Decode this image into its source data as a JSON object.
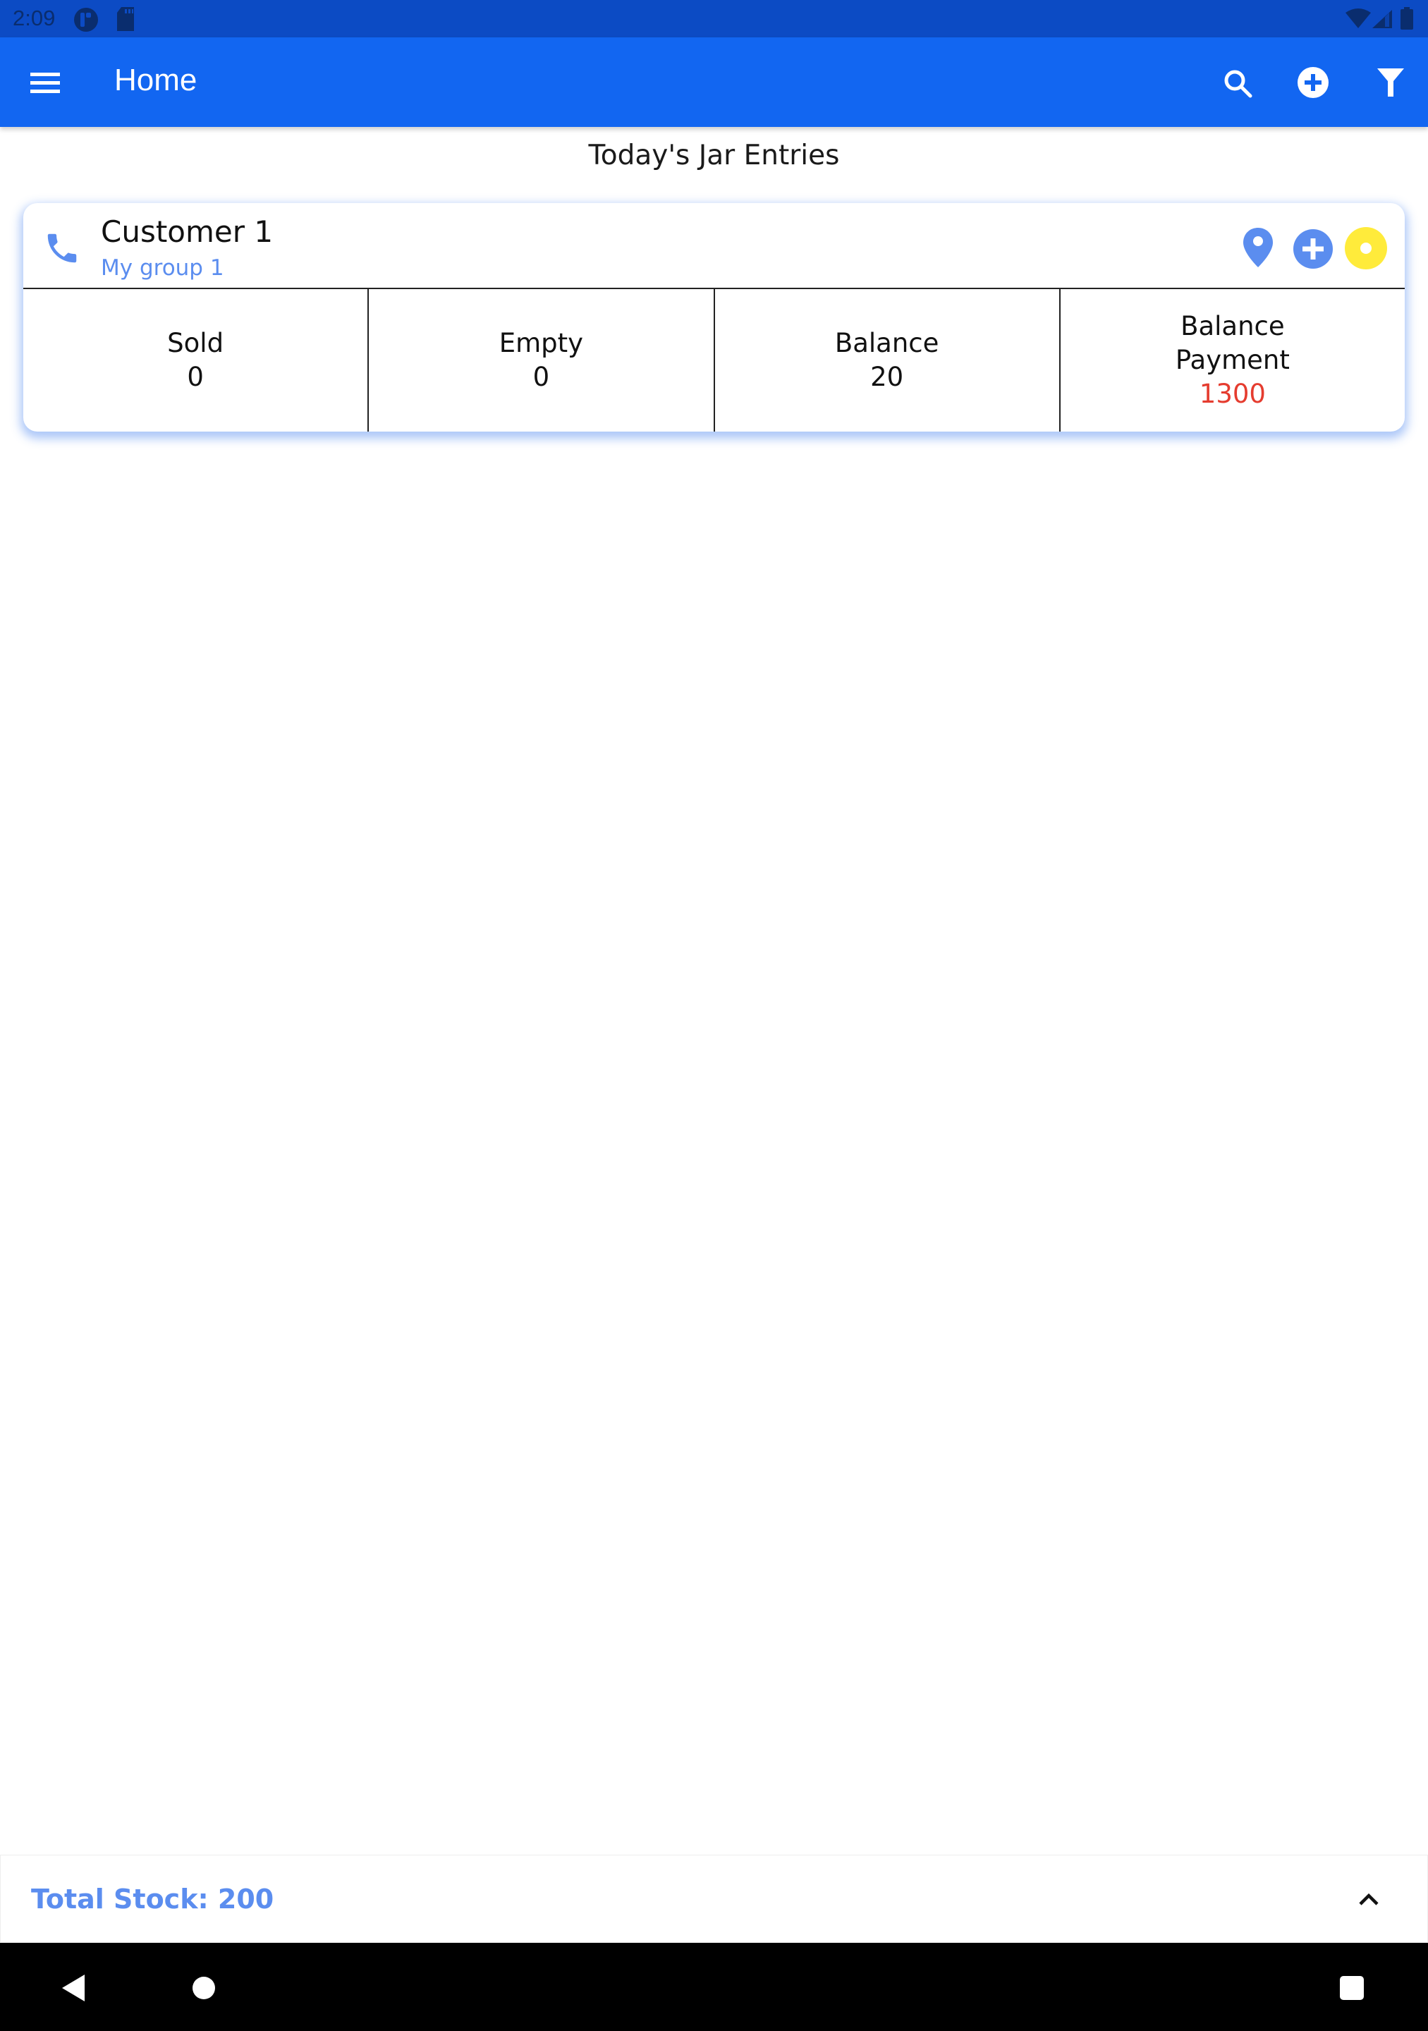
{
  "status_bar": {
    "time": "2:09",
    "left_icons": [
      "p-notification-icon",
      "sd-card-icon"
    ],
    "right_icons": [
      "wifi-icon",
      "signal-icon",
      "battery-icon"
    ]
  },
  "app_bar": {
    "title": "Home",
    "menu_icon": "hamburger-menu-icon",
    "actions": [
      {
        "name": "search",
        "icon": "search-icon"
      },
      {
        "name": "add",
        "icon": "add-circle-icon"
      },
      {
        "name": "filter",
        "icon": "filter-icon"
      }
    ]
  },
  "section": {
    "title": "Today's Jar Entries"
  },
  "entries": [
    {
      "customer_name": "Customer 1",
      "group": "My group 1",
      "icons": [
        "phone-icon",
        "location-pin-icon",
        "add-circle-icon",
        "status-dot-icon"
      ],
      "status_color": "#ffeb3b",
      "stats": [
        {
          "label": "Sold",
          "value": "0"
        },
        {
          "label": "Empty",
          "value": "0"
        },
        {
          "label": "Balance",
          "value": "20"
        },
        {
          "label_line1": "Balance",
          "label_line2": "Payment",
          "value": "1300",
          "value_color": "#e53c2f"
        }
      ]
    }
  ],
  "bottom_bar": {
    "total_stock_label": "Total Stock: 200",
    "expand_icon": "chevron-up-icon"
  },
  "nav_bar": {
    "buttons": [
      "back",
      "home",
      "recents"
    ]
  },
  "colors": {
    "primary": "#1266f1",
    "status_bar": "#0c4bc4",
    "accent_blue": "#5b8def",
    "negative": "#e53c2f",
    "status_yellow": "#ffeb3b"
  }
}
